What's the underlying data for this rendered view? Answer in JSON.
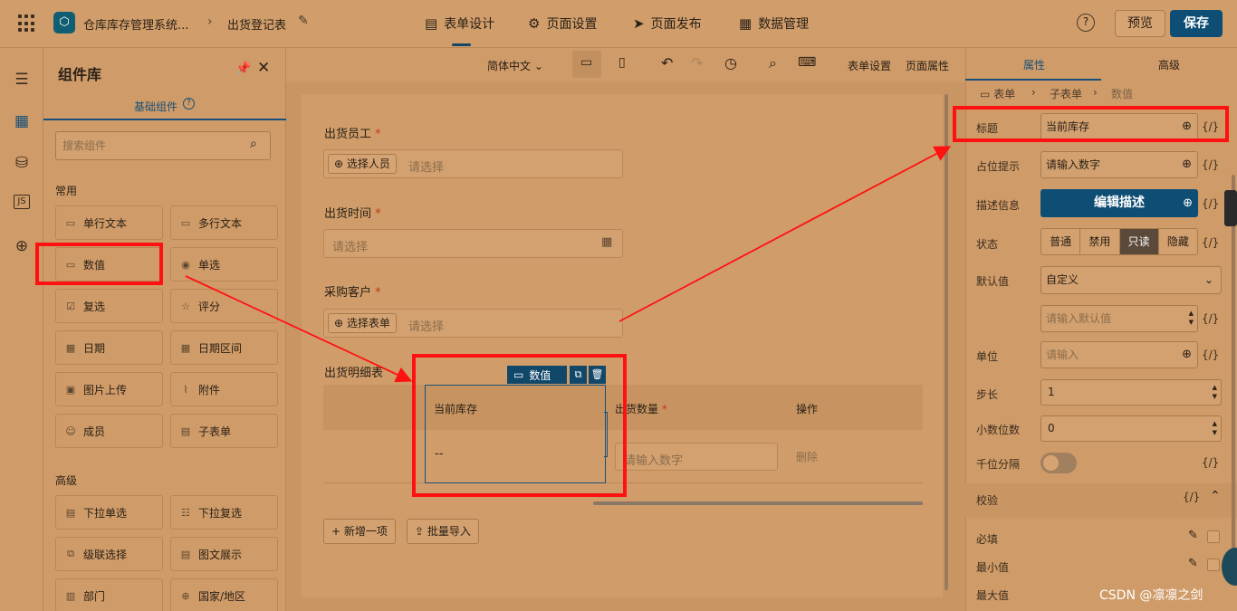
{
  "topbar": {
    "app_name": "仓库库存管理系统...",
    "form_name": "出货登记表",
    "nav_tabs": [
      {
        "label": "表单设计",
        "icon": "document-icon"
      },
      {
        "label": "页面设置",
        "icon": "gear-icon"
      },
      {
        "label": "页面发布",
        "icon": "send-icon"
      },
      {
        "label": "数据管理",
        "icon": "table-icon"
      }
    ],
    "help": "?",
    "preview_label": "预览",
    "save_label": "保存"
  },
  "library": {
    "title": "组件库",
    "tab_label": "基础组件",
    "search_placeholder": "搜索组件",
    "common_label": "常用",
    "common_items": [
      {
        "label": "单行文本",
        "icon": "single-line-icon"
      },
      {
        "label": "多行文本",
        "icon": "multi-line-icon"
      },
      {
        "label": "数值",
        "icon": "number-icon"
      },
      {
        "label": "单选",
        "icon": "radio-icon"
      },
      {
        "label": "复选",
        "icon": "checkbox-icon"
      },
      {
        "label": "评分",
        "icon": "star-icon"
      },
      {
        "label": "日期",
        "icon": "calendar-icon"
      },
      {
        "label": "日期区间",
        "icon": "date-range-icon"
      },
      {
        "label": "图片上传",
        "icon": "image-icon"
      },
      {
        "label": "附件",
        "icon": "paperclip-icon"
      },
      {
        "label": "成员",
        "icon": "user-icon"
      },
      {
        "label": "子表单",
        "icon": "subform-icon"
      }
    ],
    "advanced_label": "高级",
    "advanced_items": [
      {
        "label": "下拉单选",
        "icon": "dropdown-icon"
      },
      {
        "label": "下拉复选",
        "icon": "checklist-icon"
      },
      {
        "label": "级联选择",
        "icon": "cascade-icon"
      },
      {
        "label": "图文展示",
        "icon": "picture-text-icon"
      },
      {
        "label": "部门",
        "icon": "department-icon"
      },
      {
        "label": "国家/地区",
        "icon": "globe-icon"
      }
    ]
  },
  "toolbar": {
    "language": "简体中文",
    "form_settings": "表单设置",
    "page_props": "页面属性"
  },
  "form": {
    "fields": [
      {
        "label": "出货员工",
        "button": "选择人员",
        "placeholder": "请选择"
      },
      {
        "label": "出货时间",
        "placeholder": "请选择"
      },
      {
        "label": "采购客户",
        "button": "选择表单",
        "placeholder": "请选择"
      }
    ],
    "required_mark": "*",
    "subform": {
      "label": "出货明细表",
      "col_current_stock": "当前库存",
      "col_qty": "出货数量",
      "col_ops": "操作",
      "stock_value": "--",
      "qty_placeholder": "请输入数字",
      "delete_label": "删除",
      "selected_tag": "数值"
    },
    "add_item": "新增一项",
    "batch_import": "批量导入"
  },
  "props": {
    "tab_props": "属性",
    "tab_advanced": "高级",
    "breadcrumb": [
      "表单",
      "子表单",
      "数值"
    ],
    "title_label": "标题",
    "title_value": "当前库存",
    "placeholder_label": "占位提示",
    "placeholder_value": "请输入数字",
    "desc_label": "描述信息",
    "desc_button": "编辑描述",
    "state_label": "状态",
    "state_options": [
      "普通",
      "禁用",
      "只读",
      "隐藏"
    ],
    "state_selected": "只读",
    "default_label": "默认值",
    "default_mode": "自定义",
    "default_placeholder": "请输入默认值",
    "unit_label": "单位",
    "unit_placeholder": "请输入",
    "step_label": "步长",
    "step_value": "1",
    "decimals_label": "小数位数",
    "decimals_value": "0",
    "thousands_label": "千位分隔",
    "fx": "{/}",
    "validation_label": "校验",
    "required_label": "必填",
    "min_label": "最小值",
    "max_label": "最大值"
  },
  "watermark": "CSDN @凛凛之剑",
  "colors": {
    "accent": "#0f4e74",
    "annotation": "#ff1111",
    "background": "#cf9b68"
  }
}
